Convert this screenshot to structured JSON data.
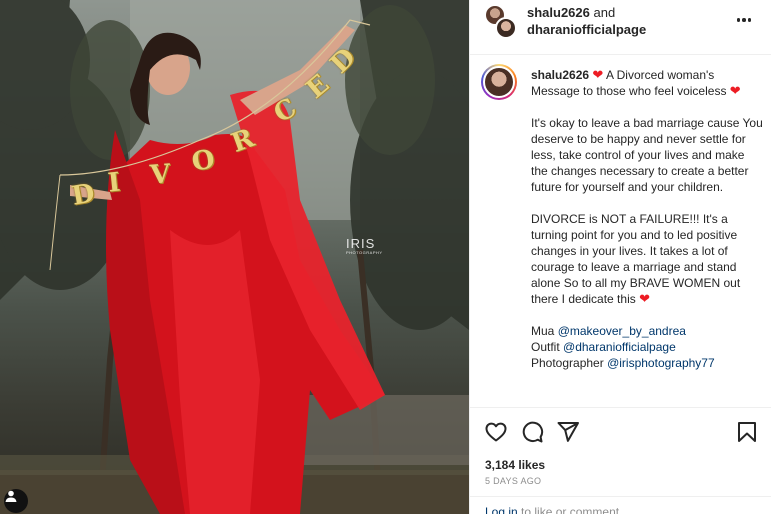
{
  "header": {
    "username": "shalu2626",
    "and_text": "and",
    "collaborator": "dharaniofficialpage"
  },
  "photo": {
    "banner_letters": [
      "D",
      "I",
      "V",
      "O",
      "R",
      "C",
      "E",
      "D"
    ],
    "watermark": "IRIS",
    "watermark_sub": "PHOTOGRAPHY",
    "dress_color": "#e2151e"
  },
  "caption": {
    "username": "shalu2626",
    "intro": "A Divorced woman's Message to those who feel voiceless",
    "para1": "It's okay to leave a bad marriage cause You deserve to be happy and never settle for less, take control of your lives and make the changes necessary to create a better future for yourself and your children.",
    "para2": "DIVORCE is NOT a FAILURE!!! It's a turning point for you and to led positive changes in your lives. It takes a lot of courage to leave a marriage and stand alone So to all my BRAVE WOMEN out there I dedicate this",
    "credit_mua_label": "Mua",
    "credit_mua": "@makeover_by_andrea",
    "credit_outfit_label": "Outfit",
    "credit_outfit": "@dharaniofficialpage",
    "credit_photo_label": "Photographer",
    "credit_photo": "@irisphotography77"
  },
  "stats": {
    "likes": "3,184 likes",
    "time_ago": "5 DAYS AGO"
  },
  "login": {
    "link": "Log in",
    "rest": "to like or comment."
  },
  "icons": [
    "heart-icon",
    "comment-icon",
    "share-icon",
    "bookmark-icon",
    "more-icon",
    "user-tag-icon"
  ],
  "colors": {
    "heart": "#ed1c24",
    "link": "#00376b",
    "muted": "#8e8e8e"
  }
}
